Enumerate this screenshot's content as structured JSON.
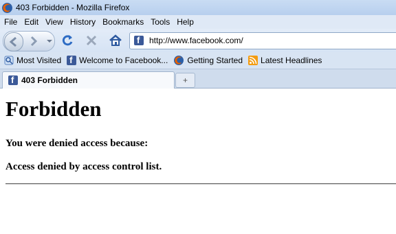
{
  "window": {
    "title": "403 Forbidden - Mozilla Firefox"
  },
  "menu": {
    "items": [
      "File",
      "Edit",
      "View",
      "History",
      "Bookmarks",
      "Tools",
      "Help"
    ]
  },
  "nav": {
    "url": "http://www.facebook.com/"
  },
  "bookmarks": {
    "items": [
      {
        "label": "Most Visited",
        "icon": "most-visited-icon"
      },
      {
        "label": "Welcome to Facebook...",
        "icon": "facebook-icon"
      },
      {
        "label": "Getting Started",
        "icon": "firefox-icon"
      },
      {
        "label": "Latest Headlines",
        "icon": "rss-icon"
      }
    ]
  },
  "tabs": {
    "active": {
      "title": "403 Forbidden",
      "icon": "facebook-icon"
    },
    "new_tab_label": "+"
  },
  "page": {
    "heading": "Forbidden",
    "line1": "You were denied access because:",
    "line2": "Access denied by access control list."
  },
  "colors": {
    "facebook": "#3b5998",
    "titlebar": "#c9dcf3"
  }
}
